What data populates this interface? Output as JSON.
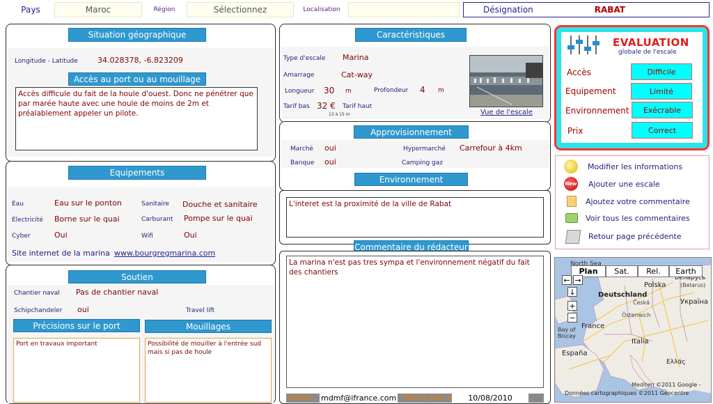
{
  "header": {
    "pays_label": "Pays",
    "pays_value": "Maroc",
    "region_label": "Région",
    "region_value": "Sélectionnez",
    "localisation_label": "Localisation",
    "designation_label": "Désignation",
    "designation_value": "RABAT"
  },
  "situation": {
    "title": "Situation géographique",
    "coords_label": "Longitude - Latitude",
    "coords_value": "34.028378, -6.823209",
    "acces_title": "Accès au port ou au mouillage",
    "acces_text": "Accès difficule du fait de la houle d'ouest. Donc ne pénétrer que par marée haute avec une houle de moins de 2m et préalablement appeler un pilote."
  },
  "equipements": {
    "title": "Equipements",
    "eau_label": "Eau",
    "eau_value": "Eau sur le ponton",
    "sanitaire_label": "Sanitaire",
    "sanitaire_value": "Douche et sanitaire",
    "electricite_label": "Electricité",
    "electricite_value": "Borne sur le quai",
    "carburant_label": "Carburant",
    "carburant_value": "Pompe sur le quai",
    "cyber_label": "Cyber",
    "cyber_value": "Oui",
    "wifi_label": "Wifi",
    "wifi_value": "Oui",
    "site_label": "Site internet de la marina",
    "site_value": "www.bourgregmarina.com"
  },
  "soutien": {
    "title": "Soutien",
    "chantier_label": "Chantier naval",
    "chantier_value": "Pas de chantier naval",
    "shipchandeler_label": "Schipchandeler",
    "shipchandeler_value": "oui",
    "travellift_label": "Travel lift",
    "precisions_title": "Précisions sur le port",
    "precisions_text": "Port en travaux important",
    "mouillages_title": "Mouillages",
    "mouillages_text": "Possibilité de mouiller à l'entrée sud mais si pas de houle"
  },
  "caracteristiques": {
    "title": "Caractéristiques",
    "type_label": "Type d'escale",
    "type_value": "Marina",
    "amarrage_label": "Amarrage",
    "amarrage_value": "Cat-way",
    "longueur_label": "Longueur",
    "longueur_value": "30",
    "longueur_unit": "m",
    "profondeur_label": "Profondeur",
    "profondeur_value": "4",
    "profondeur_unit": "m",
    "tarifbas_label": "Tarif bas",
    "tarifbas_value": "32 €",
    "tarifhaut_label": "Tarif haut",
    "tarif_note": "13 à 15 m",
    "photo_link": "Vue de l'escale"
  },
  "approvisionnement": {
    "title": "Approvisionnement",
    "marche_label": "Marché",
    "marche_value": "oui",
    "hypermarche_label": "Hypermarché",
    "hypermarche_value": "Carrefour à 4km",
    "banque_label": "Banque",
    "banque_value": "oui",
    "camping_label": "Camping gaz"
  },
  "environnement": {
    "title": "Environnement",
    "text": "L'interet est la proximité de la ville de Rabat"
  },
  "commentaire": {
    "title": "Commentaire du rédacteur",
    "text": "La marina n'est pas tres sympa et l'environnement négatif du fait des chantiers",
    "auteur_label": "Auteur",
    "auteur_value": "mdmf@ifrance.com",
    "maj_label": "Mise à jour le",
    "maj_value": "10/08/2010"
  },
  "evaluation": {
    "title": "EVALUATION",
    "subtitle": "globale de l'escale",
    "rows": [
      {
        "label": "Accès",
        "value": "Difficile"
      },
      {
        "label": "Equipement",
        "value": "Limité"
      },
      {
        "label": "Environnement",
        "value": "Exécrable"
      },
      {
        "label": "Prix",
        "value": "Correct"
      }
    ]
  },
  "actions": [
    {
      "label": "Modifier les informations",
      "icon": "edit-icon"
    },
    {
      "label": "Ajouter une escale",
      "icon": "new-icon"
    },
    {
      "label": "Ajoutez votre commentaire",
      "icon": "comment-icon"
    },
    {
      "label": "Voir tous les commentaires",
      "icon": "comments-icon"
    },
    {
      "label": "Retour page précédente",
      "icon": "back-icon"
    }
  ],
  "map": {
    "tabs": [
      "Plan",
      "Sat.",
      "Rel.",
      "Earth"
    ],
    "active_tab": "Plan",
    "labels": {
      "north_sea": "North Sea",
      "belarus": "Беларусь",
      "belarus_sub": "(Belarus)",
      "polska": "Polska",
      "deutschland": "Deutschland",
      "ukraine": "Україна",
      "ceska": "Česká",
      "osterreich": "Österreich",
      "france": "France",
      "bay": "Bay of",
      "biscay": "Biscay",
      "italia": "Italia",
      "espana": "España",
      "ellas": "Ελλάς",
      "mediterranean": "Mediterr",
      "copyright1": "©2011 Google -",
      "copyright2": "Données cartographiques ©2011 Geocentre"
    },
    "colors": {
      "sea": "#aac4e4",
      "land": "#efece6",
      "route": "#f2c95a",
      "border": "#c08aa8"
    }
  },
  "colors": {
    "title_blue": "#2f98cf",
    "value_red": "#800000",
    "label_navy": "#1e1e7a",
    "eval_border": "#ff3333",
    "eval_btn": "#00ffff"
  }
}
